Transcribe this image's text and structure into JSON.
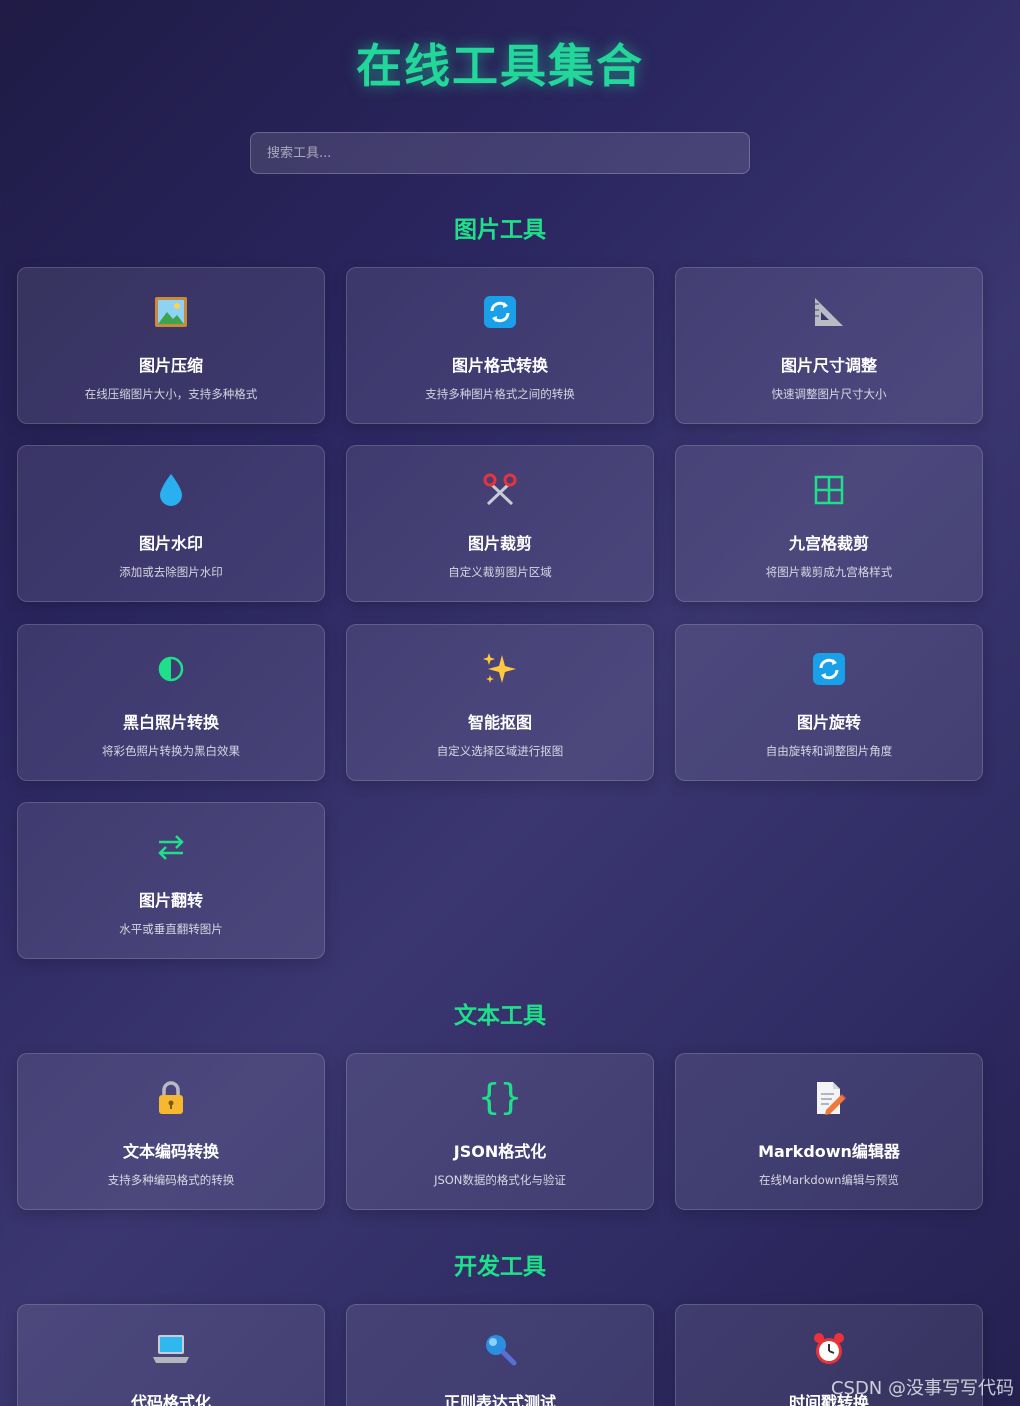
{
  "header": {
    "title": "在线工具集合"
  },
  "search": {
    "placeholder": "搜索工具..."
  },
  "sections": [
    {
      "title": "图片工具",
      "tools": [
        {
          "title": "图片压缩",
          "desc": "在线压缩图片大小，支持多种格式",
          "icon": "framed-picture-icon"
        },
        {
          "title": "图片格式转换",
          "desc": "支持多种图片格式之间的转换",
          "icon": "arrows-cycle-icon"
        },
        {
          "title": "图片尺寸调整",
          "desc": "快速调整图片尺寸大小",
          "icon": "triangular-ruler-icon"
        },
        {
          "title": "图片水印",
          "desc": "添加或去除图片水印",
          "icon": "droplet-icon"
        },
        {
          "title": "图片裁剪",
          "desc": "自定义裁剪图片区域",
          "icon": "scissors-icon"
        },
        {
          "title": "九宫格裁剪",
          "desc": "将图片裁剪成九宫格样式",
          "icon": "grid-icon"
        },
        {
          "title": "黑白照片转换",
          "desc": "将彩色照片转换为黑白效果",
          "icon": "half-circle-icon"
        },
        {
          "title": "智能抠图",
          "desc": "自定义选择区域进行抠图",
          "icon": "sparkles-icon"
        },
        {
          "title": "图片旋转",
          "desc": "自由旋转和调整图片角度",
          "icon": "arrows-cycle-icon"
        },
        {
          "title": "图片翻转",
          "desc": "水平或垂直翻转图片",
          "icon": "swap-arrows-icon"
        }
      ]
    },
    {
      "title": "文本工具",
      "tools": [
        {
          "title": "文本编码转换",
          "desc": "支持多种编码格式的转换",
          "icon": "lock-icon"
        },
        {
          "title": "JSON格式化",
          "desc": "JSON数据的格式化与验证",
          "icon": "curly-braces-icon"
        },
        {
          "title": "Markdown编辑器",
          "desc": "在线Markdown编辑与预览",
          "icon": "memo-icon"
        }
      ]
    },
    {
      "title": "开发工具",
      "tools": [
        {
          "title": "代码格式化",
          "desc": "",
          "icon": "laptop-icon"
        },
        {
          "title": "正则表达式测试",
          "desc": "",
          "icon": "magnifier-icon"
        },
        {
          "title": "时间戳转换",
          "desc": "",
          "icon": "alarm-clock-icon"
        }
      ]
    }
  ],
  "watermark": "CSDN @没事写写代码",
  "colors": {
    "accent": "#1fe08a",
    "title": "#23d69a"
  }
}
